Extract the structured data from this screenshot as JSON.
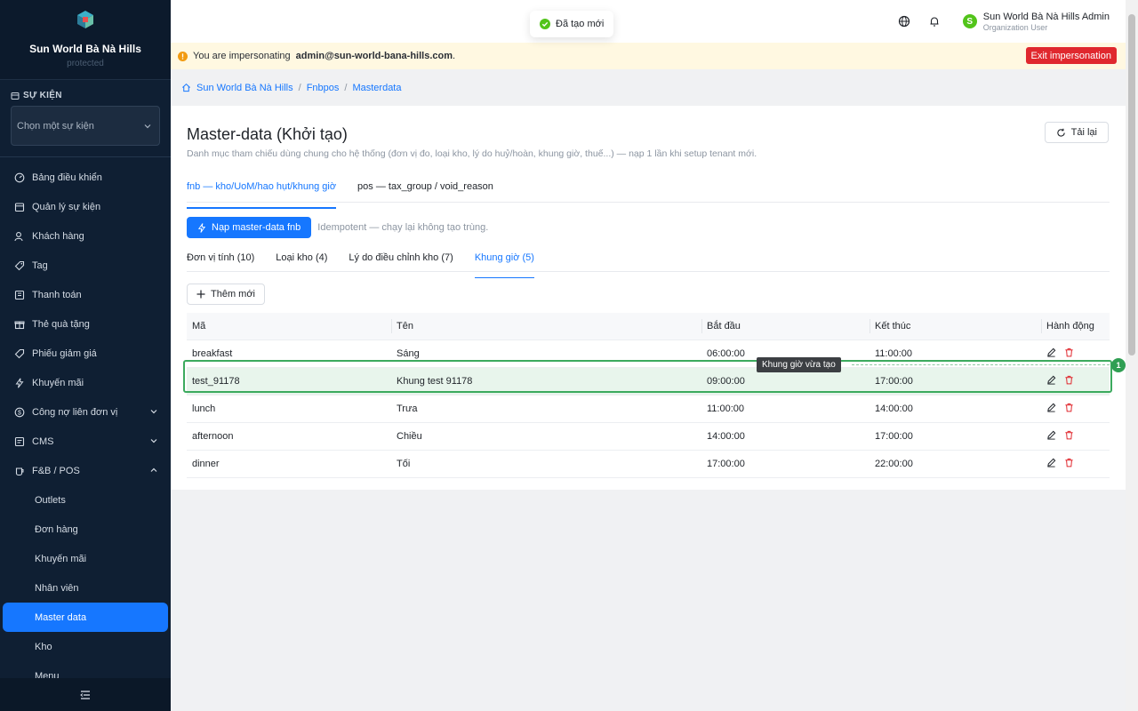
{
  "sidebar": {
    "org_name": "Sun World Bà Nà Hills",
    "org_sub": "protected",
    "section_title": "SỰ KIỆN",
    "event_select_placeholder": "Chọn một sự kiện",
    "items": [
      {
        "label": "Bảng điều khiển",
        "icon": "dashboard-icon"
      },
      {
        "label": "Quản lý sự kiện",
        "icon": "calendar-icon"
      },
      {
        "label": "Khách hàng",
        "icon": "user-icon"
      },
      {
        "label": "Tag",
        "icon": "tag-icon"
      },
      {
        "label": "Thanh toán",
        "icon": "payment-icon"
      },
      {
        "label": "Thẻ quà tặng",
        "icon": "gift-icon"
      },
      {
        "label": "Phiếu giảm giá",
        "icon": "coupon-icon"
      },
      {
        "label": "Khuyến mãi",
        "icon": "promo-icon"
      },
      {
        "label": "Công nợ liên đơn vị",
        "icon": "debt-icon"
      },
      {
        "label": "CMS",
        "icon": "cms-icon"
      },
      {
        "label": "F&B / POS",
        "icon": "fnb-icon"
      }
    ],
    "fnb_children": [
      "Outlets",
      "Đơn hàng",
      "Khuyến mãi",
      "Nhân viên",
      "Master data",
      "Kho",
      "Menu"
    ]
  },
  "topbar": {
    "user_name": "Sun World Bà Nà Hills Admin",
    "user_role": "Organization User",
    "avatar_letter": "S"
  },
  "toast": {
    "text": "Đã tạo mới"
  },
  "banner": {
    "prefix": "You are impersonating",
    "email": "admin@sun-world-bana-hills.com",
    "suffix": ".",
    "exit_label": "Exit impersonation"
  },
  "breadcrumb": [
    "Sun World Bà Nà Hills",
    "Fnbpos",
    "Masterdata"
  ],
  "page": {
    "title": "Master-data (Khởi tạo)",
    "description": "Danh mục tham chiếu dùng chung cho hệ thống (đơn vị đo, loại kho, lý do huỷ/hoàn, khung giờ, thuế...) — nạp 1 lần khi setup tenant mới.",
    "reload_label": "Tải lại",
    "tabs": [
      "fnb — kho/UoM/hao hụt/khung giờ",
      "pos — tax_group / void_reason"
    ],
    "seed_button": "Nạp master-data fnb",
    "seed_hint": "Idempotent — chạy lại không tạo trùng.",
    "subtabs": [
      "Đơn vị tính (10)",
      "Loại kho (4)",
      "Lý do điều chỉnh kho (7)",
      "Khung giờ (5)"
    ],
    "add_button": "Thêm mới"
  },
  "table": {
    "columns": [
      "Mã",
      "Tên",
      "Bắt đầu",
      "Kết thúc",
      "Hành động"
    ],
    "rows": [
      [
        "breakfast",
        "Sáng",
        "06:00:00",
        "11:00:00"
      ],
      [
        "test_91178",
        "Khung test 91178",
        "09:00:00",
        "17:00:00"
      ],
      [
        "lunch",
        "Trưa",
        "11:00:00",
        "14:00:00"
      ],
      [
        "afternoon",
        "Chiều",
        "14:00:00",
        "17:00:00"
      ],
      [
        "dinner",
        "Tối",
        "17:00:00",
        "22:00:00"
      ]
    ]
  },
  "annotation": {
    "label": "Khung giờ vừa tạo",
    "number": "1"
  }
}
